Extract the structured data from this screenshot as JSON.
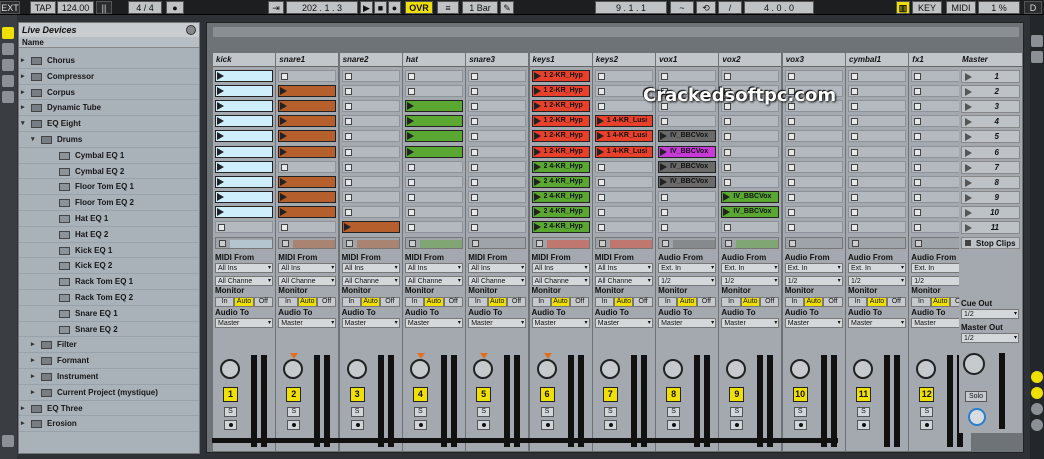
{
  "topbar": {
    "ext": "EXT",
    "tap": "TAP",
    "tempo": "124.00",
    "sig": "4 / 4",
    "position": "202 . 1 . 3",
    "ovr": "OVR",
    "quant": "1 Bar",
    "loop_start": "9 . 1 . 1",
    "loop_len": "4 . 0 . 0",
    "key": "KEY",
    "midi": "MIDI",
    "cpu": "1 %",
    "d": "D"
  },
  "browser": {
    "title": "Live Devices",
    "column": "Name",
    "items": [
      {
        "label": "Chorus",
        "level": 1
      },
      {
        "label": "Compressor",
        "level": 1
      },
      {
        "label": "Corpus",
        "level": 1
      },
      {
        "label": "Dynamic Tube",
        "level": 1
      },
      {
        "label": "EQ Eight",
        "level": 1,
        "open": true
      },
      {
        "label": "Drums",
        "level": 2,
        "open": true
      },
      {
        "label": "Cymbal EQ 1",
        "level": 3
      },
      {
        "label": "Cymbal EQ 2",
        "level": 3
      },
      {
        "label": "Floor Tom EQ 1",
        "level": 3
      },
      {
        "label": "Floor Tom EQ 2",
        "level": 3
      },
      {
        "label": "Hat EQ 1",
        "level": 3
      },
      {
        "label": "Hat EQ 2",
        "level": 3
      },
      {
        "label": "Kick EQ 1",
        "level": 3
      },
      {
        "label": "Kick EQ 2",
        "level": 3
      },
      {
        "label": "Rack Tom EQ 1",
        "level": 3
      },
      {
        "label": "Rack Tom EQ 2",
        "level": 3
      },
      {
        "label": "Snare EQ 1",
        "level": 3
      },
      {
        "label": "Snare EQ 2",
        "level": 3
      },
      {
        "label": "Filter",
        "level": 2
      },
      {
        "label": "Formant",
        "level": 2
      },
      {
        "label": "Instrument",
        "level": 2
      },
      {
        "label": "Current Project (mystique)",
        "level": 2
      },
      {
        "label": "EQ Three",
        "level": 1
      },
      {
        "label": "Erosion",
        "level": 1
      }
    ]
  },
  "tracks": [
    {
      "name": "kick",
      "num": "1",
      "type": "midi",
      "clips": [
        {
          "r": 0,
          "c": "#cfeefc",
          "t": ""
        },
        {
          "r": 1,
          "c": "#cfeefc",
          "t": ""
        },
        {
          "r": 2,
          "c": "#cfeefc",
          "t": ""
        },
        {
          "r": 3,
          "c": "#cfeefc",
          "t": ""
        },
        {
          "r": 4,
          "c": "#cfeefc",
          "t": ""
        },
        {
          "r": 5,
          "c": "#cfeefc",
          "t": ""
        },
        {
          "r": 6,
          "c": "#cfeefc",
          "t": ""
        },
        {
          "r": 7,
          "c": "#cfeefc",
          "t": ""
        },
        {
          "r": 8,
          "c": "#cfeefc",
          "t": ""
        },
        {
          "r": 9,
          "c": "#cfeefc",
          "t": ""
        }
      ]
    },
    {
      "name": "snare1",
      "num": "2",
      "type": "midi",
      "clips": [
        {
          "r": 1,
          "c": "#b5602c",
          "t": ""
        },
        {
          "r": 2,
          "c": "#b5602c",
          "t": ""
        },
        {
          "r": 3,
          "c": "#b5602c",
          "t": ""
        },
        {
          "r": 4,
          "c": "#b5602c",
          "t": ""
        },
        {
          "r": 5,
          "c": "#b5602c",
          "t": ""
        },
        {
          "r": 7,
          "c": "#b5602c",
          "t": ""
        },
        {
          "r": 8,
          "c": "#b5602c",
          "t": ""
        },
        {
          "r": 9,
          "c": "#b5602c",
          "t": ""
        }
      ]
    },
    {
      "name": "snare2",
      "num": "3",
      "type": "midi",
      "clips": [
        {
          "r": 10,
          "c": "#b5602c",
          "t": ""
        }
      ]
    },
    {
      "name": "hat",
      "num": "4",
      "type": "midi",
      "clips": [
        {
          "r": 2,
          "c": "#5aa832",
          "t": ""
        },
        {
          "r": 3,
          "c": "#5aa832",
          "t": ""
        },
        {
          "r": 4,
          "c": "#5aa832",
          "t": ""
        },
        {
          "r": 5,
          "c": "#5aa832",
          "t": ""
        }
      ]
    },
    {
      "name": "snare3",
      "num": "5",
      "type": "midi",
      "clips": []
    },
    {
      "name": "keys1",
      "num": "6",
      "type": "midi",
      "clips": [
        {
          "r": 0,
          "c": "#e8402a",
          "t": "1 2-KR_Hyp"
        },
        {
          "r": 1,
          "c": "#e8402a",
          "t": "1 2-KR_Hyp"
        },
        {
          "r": 2,
          "c": "#e8402a",
          "t": "1 2-KR_Hyp"
        },
        {
          "r": 3,
          "c": "#e8402a",
          "t": "1 2-KR_Hyp"
        },
        {
          "r": 4,
          "c": "#e8402a",
          "t": "1 2-KR_Hyp"
        },
        {
          "r": 5,
          "c": "#e8402a",
          "t": "1 2-KR_Hyp"
        },
        {
          "r": 6,
          "c": "#5aa832",
          "t": "2 4-KR_Hyp"
        },
        {
          "r": 7,
          "c": "#5aa832",
          "t": "2 4-KR_Hyp"
        },
        {
          "r": 8,
          "c": "#5aa832",
          "t": "2 4-KR_Hyp"
        },
        {
          "r": 9,
          "c": "#5aa832",
          "t": "2 4-KR_Hyp"
        },
        {
          "r": 10,
          "c": "#5aa832",
          "t": "2 4-KR_Hyp"
        }
      ]
    },
    {
      "name": "keys2",
      "num": "7",
      "type": "midi",
      "clips": [
        {
          "r": 3,
          "c": "#e8402a",
          "t": "1 4-KR_Lusi"
        },
        {
          "r": 4,
          "c": "#e8402a",
          "t": "1 4-KR_Lusi"
        },
        {
          "r": 5,
          "c": "#e8402a",
          "t": "1 4-KR_Lusi"
        }
      ]
    },
    {
      "name": "vox1",
      "num": "8",
      "type": "audio",
      "clips": [
        {
          "r": 4,
          "c": "#6a6a6a",
          "t": "IV_BBCVox"
        },
        {
          "r": 5,
          "c": "#c83ad8",
          "t": "IV_BBCVox"
        },
        {
          "r": 6,
          "c": "#6a6a6a",
          "t": "IV_BBCVox"
        },
        {
          "r": 7,
          "c": "#6a6a6a",
          "t": "IV_BBCVox"
        }
      ]
    },
    {
      "name": "vox2",
      "num": "9",
      "type": "audio",
      "clips": [
        {
          "r": 8,
          "c": "#5aa832",
          "t": "IV_BBCVox"
        },
        {
          "r": 9,
          "c": "#5aa832",
          "t": "IV_BBCVox"
        }
      ]
    },
    {
      "name": "vox3",
      "num": "10",
      "type": "audio",
      "clips": []
    },
    {
      "name": "cymbal1",
      "num": "11",
      "type": "audio",
      "clips": []
    },
    {
      "name": "fx1",
      "num": "12",
      "type": "audio",
      "clips": []
    }
  ],
  "io": {
    "midi_from": "MIDI From",
    "audio_from": "Audio From",
    "all_ins": "All Ins",
    "ext_in": "Ext. In",
    "all_channels": "All Channe",
    "ch12": "1/2",
    "monitor": "Monitor",
    "in": "In",
    "auto": "Auto",
    "off": "Off",
    "audio_to": "Audio To",
    "master": "Master",
    "solo": "S"
  },
  "master": {
    "name": "Master",
    "scenes": [
      "1",
      "2",
      "3",
      "4",
      "5",
      "6",
      "7",
      "8",
      "9",
      "10",
      "11"
    ],
    "stop_clips": "Stop Clips",
    "cue_out": "Cue Out",
    "cue_val": "1/2",
    "master_out": "Master Out",
    "master_val": "1/2",
    "solo": "Solo"
  },
  "watermark": "Crackedsoftpc.com"
}
